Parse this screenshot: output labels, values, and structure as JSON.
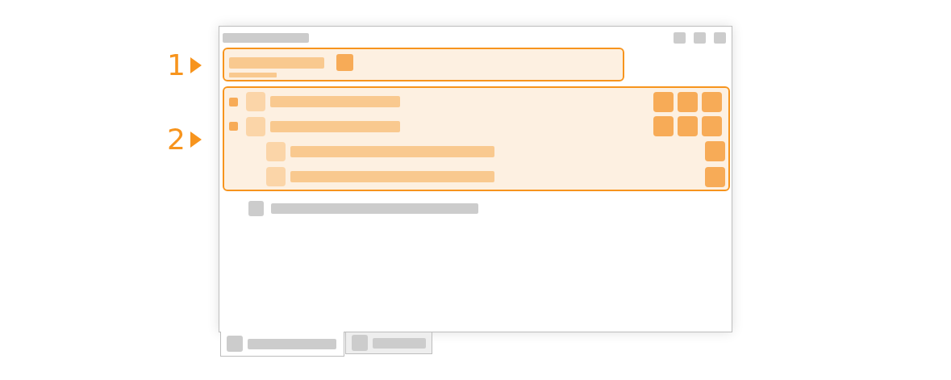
{
  "callouts": [
    {
      "label": "1"
    },
    {
      "label": "2"
    }
  ],
  "header": {
    "highlighted": true
  },
  "section": {
    "highlighted": true,
    "rows": [
      {
        "kind": "group"
      },
      {
        "kind": "group"
      },
      {
        "kind": "child"
      },
      {
        "kind": "child"
      }
    ]
  },
  "other_rows": [
    {
      "kind": "plain"
    }
  ],
  "tabs": [
    {
      "selected": true
    },
    {
      "selected": false
    }
  ]
}
